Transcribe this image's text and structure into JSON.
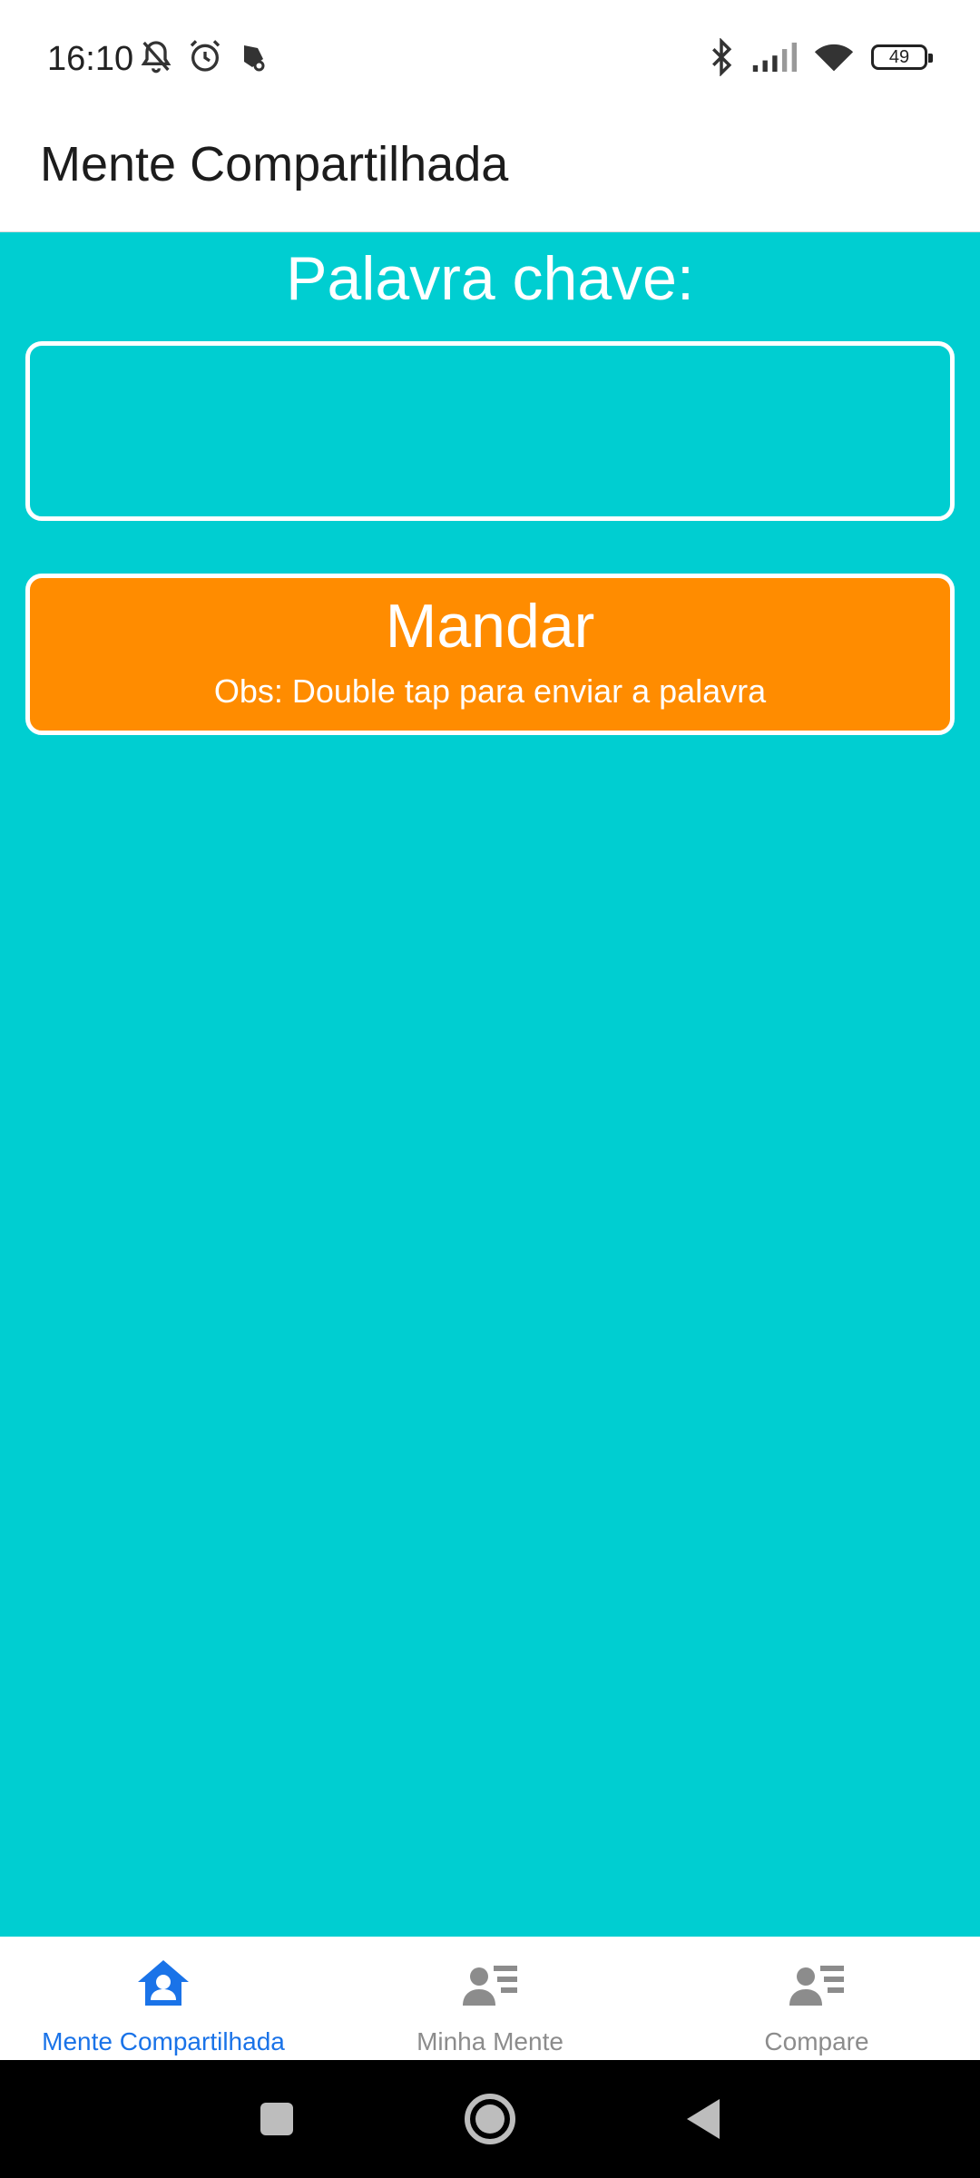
{
  "status_bar": {
    "time": "16:10",
    "battery_level": "49",
    "left_icons": [
      "bell-off-icon",
      "alarm-icon",
      "app-notification-icon"
    ],
    "right_icons": [
      "bluetooth-icon",
      "signal-icon",
      "wifi-icon",
      "battery-icon"
    ]
  },
  "app_bar": {
    "title": "Mente Compartilhada"
  },
  "main": {
    "keyword_label": "Palavra chave:",
    "keyword_input_value": "",
    "keyword_input_placeholder": "",
    "send_button_label": "Mandar",
    "send_button_note": "Obs: Double tap para enviar a palavra"
  },
  "tab_bar": {
    "tabs": [
      {
        "label": "Mente Compartilhada",
        "icon": "home-person-icon",
        "active": true
      },
      {
        "label": "Minha Mente",
        "icon": "person-list-icon",
        "active": false
      },
      {
        "label": "Compare",
        "icon": "person-list-icon",
        "active": false
      }
    ]
  },
  "nav_bar": {
    "buttons": [
      "recents-square-icon",
      "home-circle-icon",
      "back-triangle-icon"
    ]
  },
  "colors": {
    "background": "#00ced1",
    "button": "#ff8c00",
    "active_tab": "#1a73e8",
    "inactive_tab": "#8c8c8c"
  }
}
